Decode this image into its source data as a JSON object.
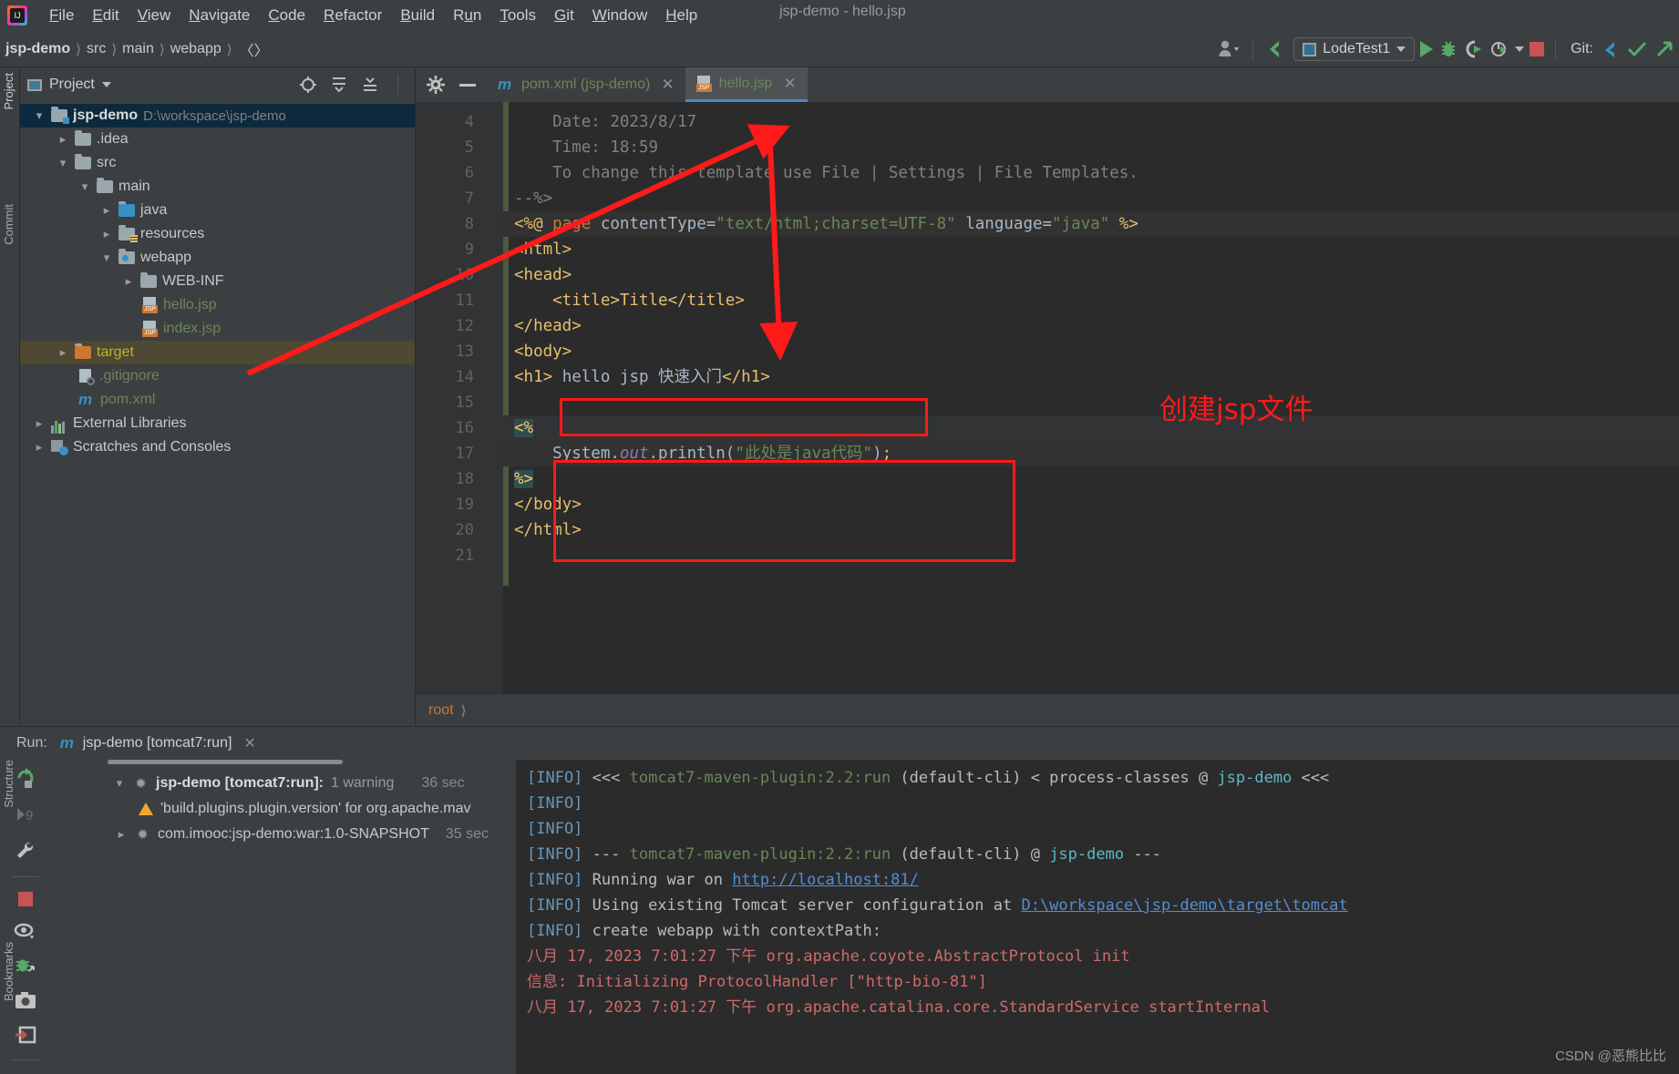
{
  "window": {
    "title": "jsp-demo - hello.jsp"
  },
  "menubar": {
    "items": [
      "File",
      "Edit",
      "View",
      "Navigate",
      "Code",
      "Refactor",
      "Build",
      "Run",
      "Tools",
      "Git",
      "Window",
      "Help"
    ]
  },
  "navbar": {
    "crumbs": [
      "jsp-demo",
      "src",
      "main",
      "webapp"
    ],
    "code_crumb": "〈〉",
    "run_config": "LodeTest1",
    "git_label": "Git:"
  },
  "project_pane": {
    "title": "Project",
    "vertical_tabs": [
      "Project",
      "Commit",
      "Structure",
      "Bookmarks"
    ],
    "tree": [
      {
        "label": "jsp-demo",
        "path": "D:\\workspace\\jsp-demo",
        "depth": 0,
        "arrow": "v",
        "icon": "module-folder-icon",
        "style": "bold",
        "state": "selected"
      },
      {
        "label": ".idea",
        "path": "",
        "depth": 1,
        "arrow": ">",
        "icon": "folder-icon",
        "style": "white",
        "state": ""
      },
      {
        "label": "src",
        "path": "",
        "depth": 1,
        "arrow": "v",
        "icon": "folder-icon",
        "style": "white",
        "state": ""
      },
      {
        "label": "main",
        "path": "",
        "depth": 2,
        "arrow": "v",
        "icon": "folder-icon",
        "style": "white",
        "state": ""
      },
      {
        "label": "java",
        "path": "",
        "depth": 3,
        "arrow": ">",
        "icon": "source-folder-icon",
        "style": "white",
        "state": ""
      },
      {
        "label": "resources",
        "path": "",
        "depth": 3,
        "arrow": ">",
        "icon": "resources-folder-icon",
        "style": "white",
        "state": ""
      },
      {
        "label": "webapp",
        "path": "",
        "depth": 3,
        "arrow": "v",
        "icon": "webapp-folder-icon",
        "style": "white",
        "state": ""
      },
      {
        "label": "WEB-INF",
        "path": "",
        "depth": 4,
        "arrow": ">",
        "icon": "folder-icon",
        "style": "white",
        "state": ""
      },
      {
        "label": "hello.jsp",
        "path": "",
        "depth": 5,
        "arrow": "",
        "icon": "jsp-file-icon",
        "style": "green",
        "state": ""
      },
      {
        "label": "index.jsp",
        "path": "",
        "depth": 5,
        "arrow": "",
        "icon": "jsp-file-icon",
        "style": "green",
        "state": ""
      },
      {
        "label": "target",
        "path": "",
        "depth": 1,
        "arrow": ">",
        "icon": "excluded-folder-icon",
        "style": "yellow",
        "state": "highlighted"
      },
      {
        "label": ".gitignore",
        "path": "",
        "depth": 2,
        "arrow": "",
        "icon": "gitignore-file-icon",
        "style": "green",
        "state": ""
      },
      {
        "label": "pom.xml",
        "path": "",
        "depth": 2,
        "arrow": "",
        "icon": "maven-file-icon",
        "style": "green",
        "state": ""
      },
      {
        "label": "External Libraries",
        "path": "",
        "depth": 0,
        "arrow": ">",
        "icon": "libraries-icon",
        "style": "white",
        "state": ""
      },
      {
        "label": "Scratches and Consoles",
        "path": "",
        "depth": 0,
        "arrow": ">",
        "icon": "scratches-icon",
        "style": "white",
        "state": ""
      }
    ]
  },
  "editor": {
    "tabs": [
      {
        "label": "pom.xml (jsp-demo)",
        "icon": "maven-file-icon",
        "active": false
      },
      {
        "label": "hello.jsp",
        "icon": "jsp-file-icon",
        "active": true
      }
    ],
    "breadcrumb": "root",
    "first_line_number": 4,
    "lines": [
      {
        "n": 4,
        "text": "    Date: 2023/8/17"
      },
      {
        "n": 5,
        "text": "    Time: 18:59"
      },
      {
        "n": 6,
        "text": "    To change this template use File | Settings | File Templates."
      },
      {
        "n": 7,
        "text": "--%>"
      },
      {
        "n": 8,
        "text": "<%@ page contentType=\"text/html;charset=UTF-8\" language=\"java\" %>"
      },
      {
        "n": 9,
        "text": "<html>"
      },
      {
        "n": 10,
        "text": "<head>"
      },
      {
        "n": 11,
        "text": "    <title>Title</title>"
      },
      {
        "n": 12,
        "text": "</head>"
      },
      {
        "n": 13,
        "text": "<body>"
      },
      {
        "n": 14,
        "text": "<h1> hello jsp 快速入门</h1>"
      },
      {
        "n": 15,
        "text": ""
      },
      {
        "n": 16,
        "text": "<%"
      },
      {
        "n": 17,
        "text": "    System.out.println(\"此处是java代码\");"
      },
      {
        "n": 18,
        "text": "%>"
      },
      {
        "n": 19,
        "text": "</body>"
      },
      {
        "n": 20,
        "text": "</html>"
      },
      {
        "n": 21,
        "text": ""
      }
    ]
  },
  "run_panel": {
    "label": "Run:",
    "tab": "jsp-demo [tomcat7:run]",
    "tree": [
      {
        "label": "jsp-demo [tomcat7:run]:",
        "detail": "1 warning",
        "time": "36 sec",
        "icon": "spinner-icon",
        "arrow": "v",
        "level": 1
      },
      {
        "label": "'build.plugins.plugin.version' for org.apache.mav",
        "detail": "",
        "time": "",
        "icon": "warning-icon",
        "arrow": "",
        "level": 2
      },
      {
        "label": "com.imooc:jsp-demo:war:1.0-SNAPSHOT",
        "detail": "",
        "time": "35 sec",
        "icon": "spinner-icon",
        "arrow": ">",
        "level": 2
      }
    ],
    "console": [
      {
        "type": "info",
        "text": "[INFO] <<< tomcat7-maven-plugin:2.2:run (default-cli) < process-classes @ jsp-demo <<<"
      },
      {
        "type": "info",
        "text": "[INFO]"
      },
      {
        "type": "info",
        "text": "[INFO]"
      },
      {
        "type": "info",
        "text": "[INFO] --- tomcat7-maven-plugin:2.2:run (default-cli) @ jsp-demo ---"
      },
      {
        "type": "info-link",
        "text": "[INFO] Running war on http://localhost:81/",
        "link": "http://localhost:81/"
      },
      {
        "type": "info-link",
        "text": "[INFO] Using existing Tomcat server configuration at D:\\workspace\\jsp-demo\\target\\tomcat",
        "link": "D:\\workspace\\jsp-demo\\target\\tomcat"
      },
      {
        "type": "info",
        "text": "[INFO] create webapp with contextPath:"
      },
      {
        "type": "err",
        "text": "八月 17, 2023 7:01:27 下午 org.apache.coyote.AbstractProtocol init"
      },
      {
        "type": "err",
        "text": "信息: Initializing ProtocolHandler [\"http-bio-81\"]"
      },
      {
        "type": "err",
        "text": "八月 17, 2023 7:01:27 下午 org.apache.catalina.core.StandardService startInternal"
      }
    ],
    "watermark": "CSDN @恶熊比比",
    "toolbar_icons": [
      "rerun-icon",
      "skip-to-end-icon",
      "settings-wrench-icon",
      "stop-icon",
      "soft-wrap-icon",
      "debug-icon",
      "screenshot-icon",
      "export-icon"
    ]
  },
  "annotations": {
    "label": "创建jsp文件",
    "color": "#ff1a1a"
  },
  "colors": {
    "accent_blue": "#4a88c7",
    "green": "#59a869",
    "red": "#c75450",
    "annotation_red": "#ff1a1a",
    "panel_bg": "#3c3f41",
    "editor_bg": "#2b2b2b",
    "selection_blue": "#0d293e"
  }
}
